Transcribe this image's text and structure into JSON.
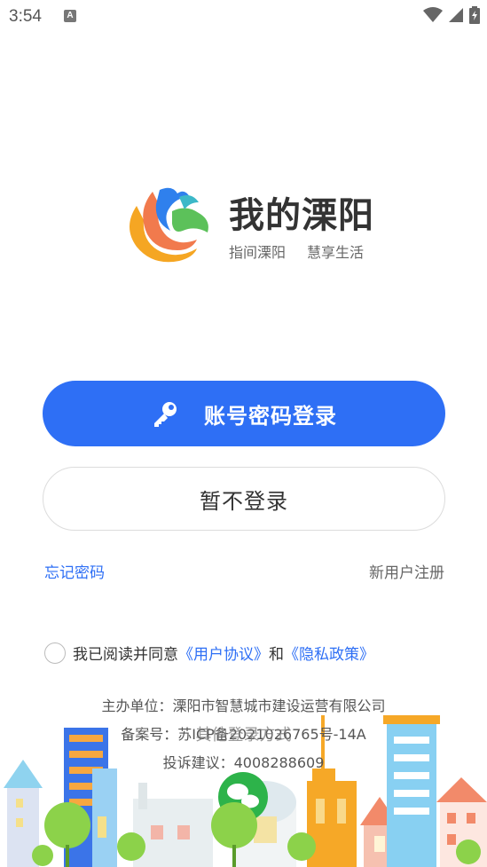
{
  "status_bar": {
    "time": "3:54",
    "notification_badge": "A"
  },
  "app": {
    "title": "我的溧阳",
    "slogan_left": "指间溧阳",
    "slogan_right": "慧享生活"
  },
  "login": {
    "primary_label": "账号密码登录",
    "secondary_label": "暂不登录",
    "forgot_password": "忘记密码",
    "register": "新用户注册"
  },
  "agreement": {
    "prefix": "我已阅读并同意",
    "user_agreement": "《用户协议》",
    "and": "和",
    "privacy_policy": "《隐私政策》"
  },
  "footer": {
    "organizer": "主办单位：溧阳市智慧城市建设运营有限公司",
    "icp": "备案号：苏ICP备2021026765号-14A",
    "complaint": "投诉建议：4008288609",
    "other_login": "其他登录方式"
  },
  "colors": {
    "accent": "#2e6ff5",
    "text": "#333333",
    "muted": "#666666"
  }
}
